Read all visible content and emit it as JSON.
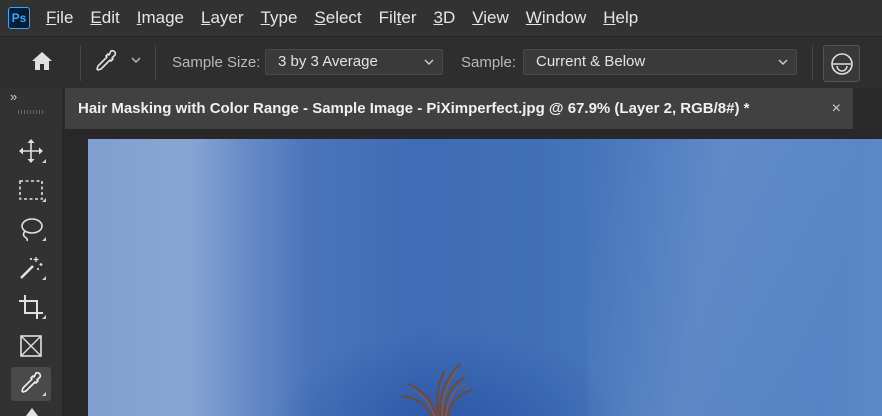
{
  "app": {
    "logo_text": "Ps"
  },
  "menu": [
    {
      "pre": "",
      "u": "F",
      "post": "ile"
    },
    {
      "pre": "",
      "u": "E",
      "post": "dit"
    },
    {
      "pre": "",
      "u": "I",
      "post": "mage"
    },
    {
      "pre": "",
      "u": "L",
      "post": "ayer"
    },
    {
      "pre": "",
      "u": "T",
      "post": "ype"
    },
    {
      "pre": "",
      "u": "S",
      "post": "elect"
    },
    {
      "pre": "Fil",
      "u": "t",
      "post": "er"
    },
    {
      "pre": "",
      "u": "3",
      "post": "D"
    },
    {
      "pre": "",
      "u": "V",
      "post": "iew"
    },
    {
      "pre": "",
      "u": "W",
      "post": "indow"
    },
    {
      "pre": "",
      "u": "H",
      "post": "elp"
    }
  ],
  "options": {
    "sample_size_label": "Sample Size:",
    "sample_size_value": "3 by 3 Average",
    "sample_label": "Sample:",
    "sample_value": "Current & Below"
  },
  "toolbar": {
    "expander": "»",
    "tools": [
      "move-tool",
      "marquee-tool",
      "lasso-tool",
      "magic-wand-tool",
      "crop-tool",
      "frame-tool",
      "eyedropper-tool"
    ],
    "active_tool": "eyedropper-tool"
  },
  "document": {
    "tab_title": "Hair Masking with Color Range - Sample Image - PiXimperfect.jpg @ 67.9% (Layer 2, RGB/8#) *",
    "close_glyph": "×"
  },
  "colors": {
    "accent": "#31a8ff",
    "sky": "#4170b8"
  }
}
